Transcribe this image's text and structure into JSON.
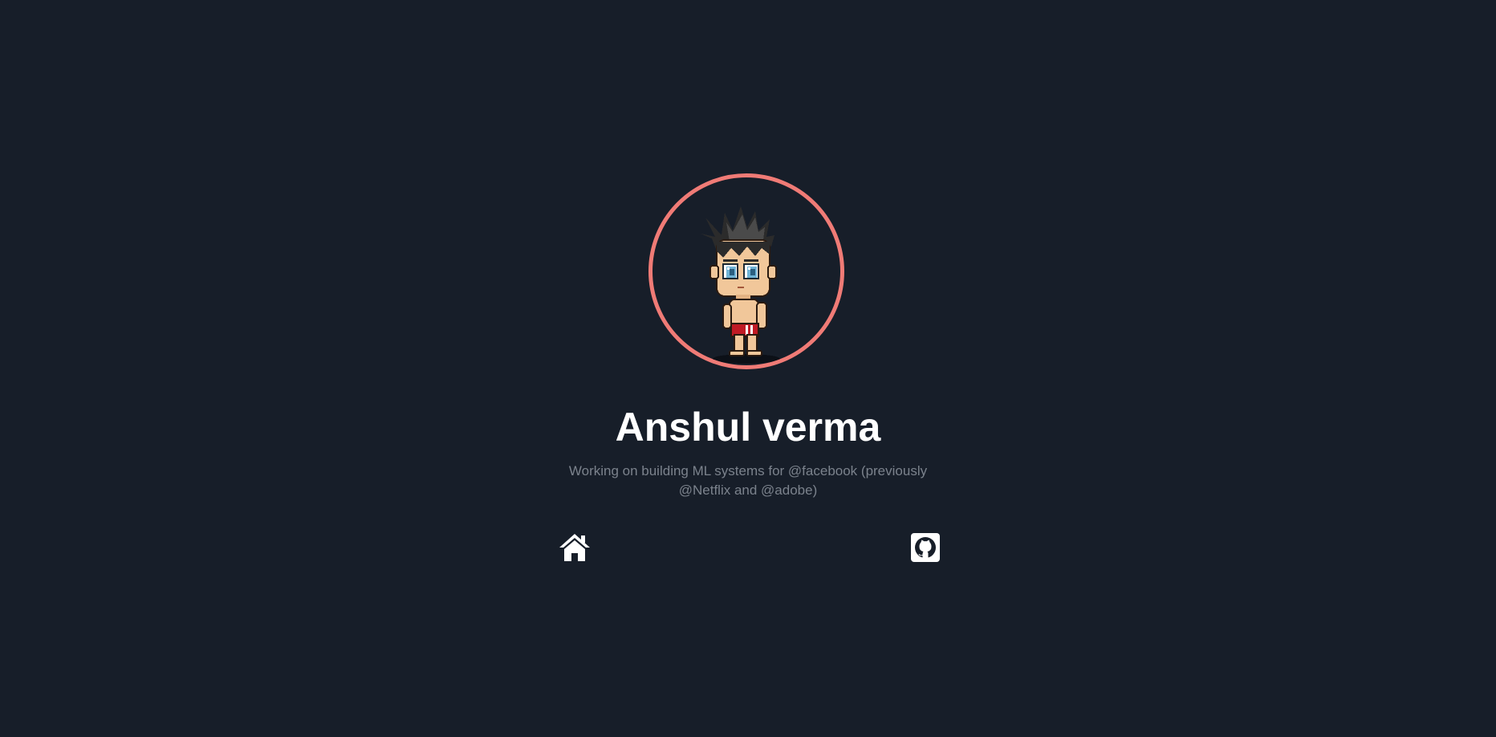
{
  "profile": {
    "name": "Anshul verma",
    "bio": "Working on building ML systems for @facebook (previously @Netflix and @adobe)",
    "avatar_icon": "pixel-character-avatar",
    "ring_color": "#f07b76",
    "background_color": "#171e29",
    "name_color": "#ffffff",
    "bio_color": "#7b828c"
  },
  "links": [
    {
      "icon": "home-icon"
    },
    {
      "icon": "github-icon"
    }
  ]
}
